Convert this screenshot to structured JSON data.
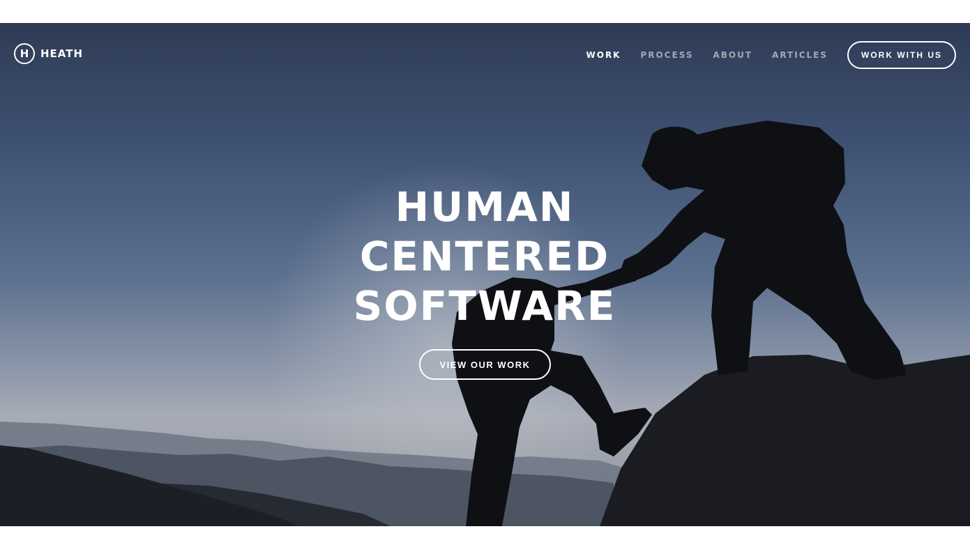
{
  "header": {
    "brand_mark": "H",
    "brand_name": "HEATH",
    "nav": [
      {
        "label": "WORK",
        "active": true
      },
      {
        "label": "PROCESS",
        "active": false
      },
      {
        "label": "ABOUT",
        "active": false
      },
      {
        "label": "ARTICLES",
        "active": false
      }
    ],
    "cta_label": "WORK WITH US"
  },
  "hero": {
    "headline_lines": [
      "HUMAN",
      "CENTERED",
      "SOFTWARE"
    ],
    "button_label": "VIEW OUR WORK",
    "image_subject": "two-climbers-silhouette-icon"
  },
  "colors": {
    "sky_top": "#2e3b55",
    "sky_horizon": "#a7acb6",
    "silhouette": "#0f1014",
    "text": "#ffffff"
  }
}
